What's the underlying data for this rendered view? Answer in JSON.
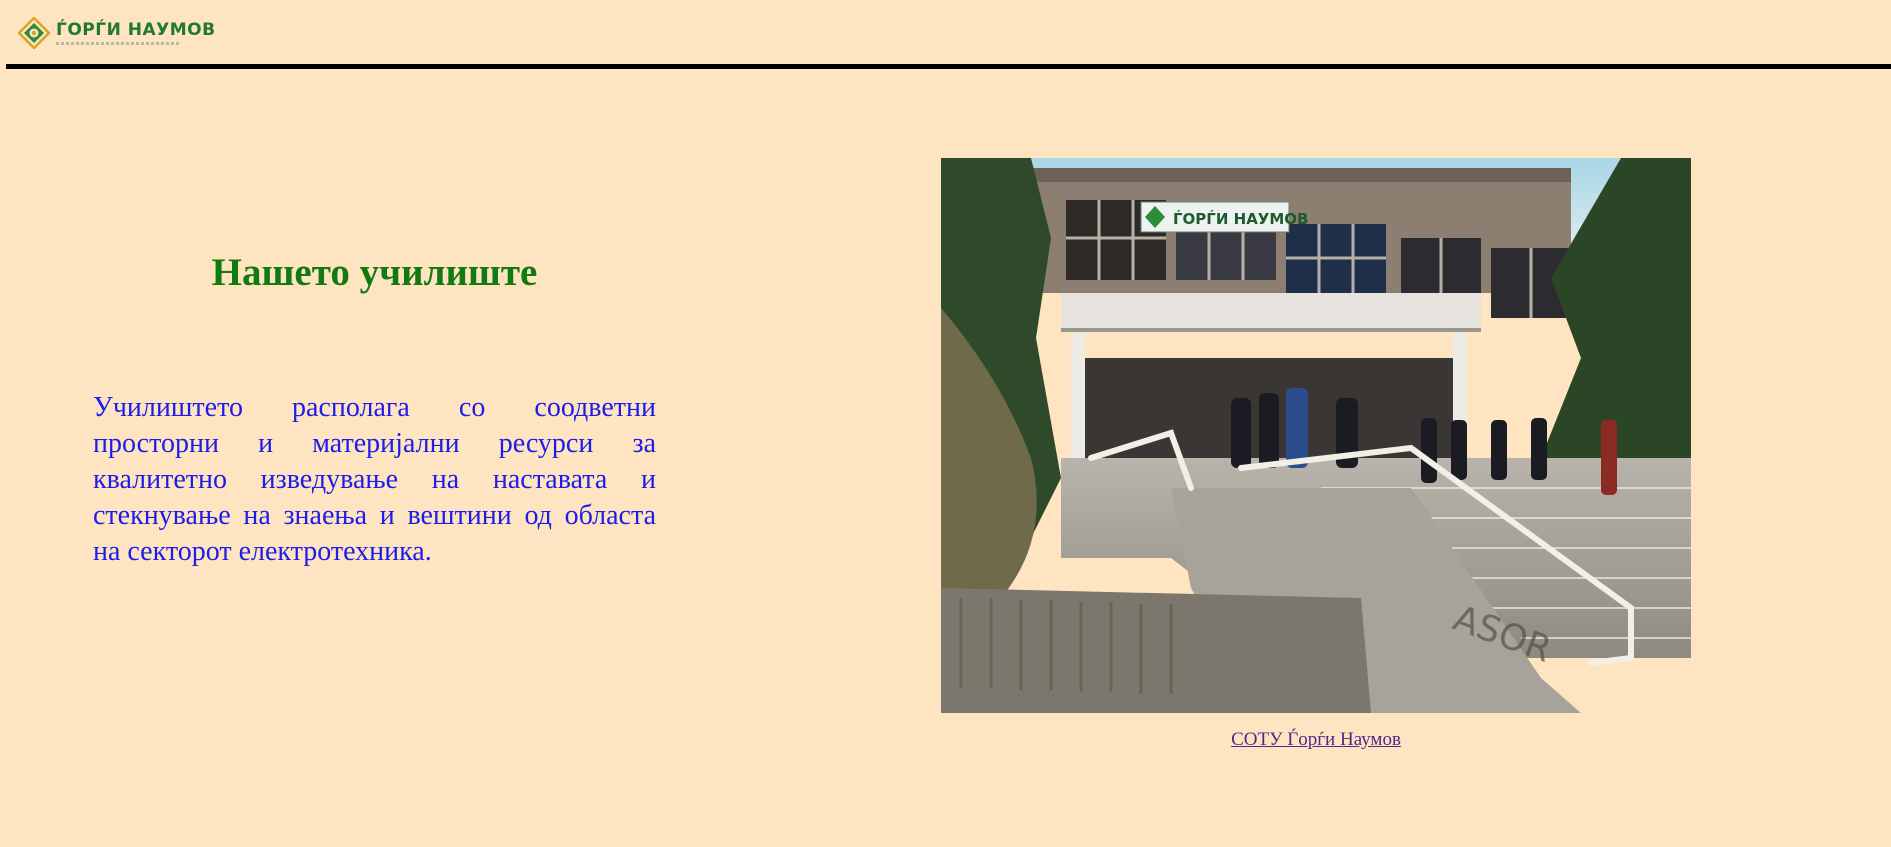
{
  "header": {
    "logo_text": "ЃОРЃИ НАУМОВ",
    "logo_icon": "school-emblem-icon"
  },
  "main": {
    "title": "Нашето училиште",
    "description": "Училиштето располага со соодветни просторни и материјални ресурси за квалитетно изведување на наставата и стекнување на знаења и вештини од областа на секторот електротехника.",
    "photo": {
      "sign_text": "ЃОРЃИ НАУМОВ"
    },
    "caption_link": "СОТУ Ѓорѓи Наумов"
  },
  "colors": {
    "background": "#FFE4C2",
    "title": "#117A11",
    "body_text": "#1D1DEB",
    "link": "#4B2A8A",
    "rule": "#000000",
    "logo_green": "#1E7A2E"
  }
}
